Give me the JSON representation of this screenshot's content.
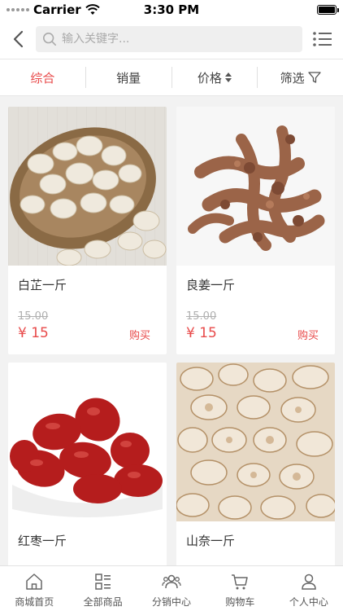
{
  "status_bar": {
    "carrier": "Carrier",
    "time": "3:30 PM"
  },
  "search": {
    "placeholder": "输入关键字..."
  },
  "sort_tabs": [
    {
      "label": "综合",
      "active": true
    },
    {
      "label": "销量",
      "active": false
    },
    {
      "label": "价格",
      "active": false
    },
    {
      "label": "筛选",
      "active": false
    }
  ],
  "products": [
    {
      "name": "白芷一斤",
      "old_price": "15.00",
      "price": "¥ 15",
      "buy_label": "购买",
      "image": "sliced-herb-basket"
    },
    {
      "name": "良姜一斤",
      "old_price": "15.00",
      "price": "¥ 15",
      "buy_label": "购买",
      "image": "galangal-roots"
    },
    {
      "name": "红枣一斤",
      "image": "red-dates"
    },
    {
      "name": "山奈一斤",
      "image": "kaempferia-slices"
    }
  ],
  "tabbar": [
    {
      "label": "商城首页",
      "icon": "home-icon"
    },
    {
      "label": "全部商品",
      "icon": "category-icon"
    },
    {
      "label": "分销中心",
      "icon": "users-icon"
    },
    {
      "label": "购物车",
      "icon": "cart-icon"
    },
    {
      "label": "个人中心",
      "icon": "person-icon"
    }
  ],
  "colors": {
    "accent": "#e84a4a",
    "muted": "#b0b0b0"
  }
}
